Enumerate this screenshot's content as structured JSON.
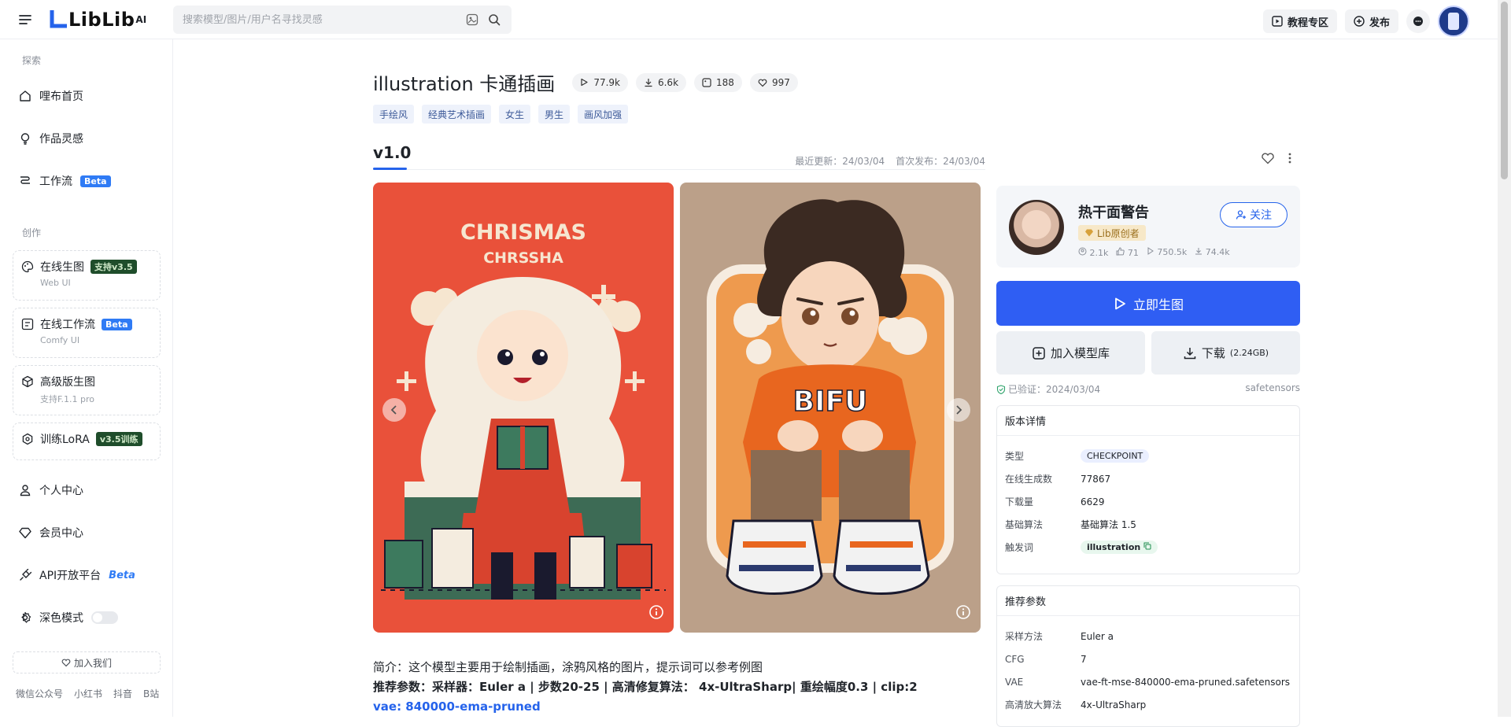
{
  "topbar": {
    "logo_text": "LibLib",
    "logo_ai": "AI",
    "search_placeholder": "搜索模型/图片/用户名寻找灵感",
    "tutorial_label": "教程专区",
    "publish_label": "发布"
  },
  "sidebar": {
    "explore_label": "探索",
    "explore_items": [
      {
        "label": "哩布首页"
      },
      {
        "label": "作品灵感"
      },
      {
        "label": "工作流",
        "badge": "Beta"
      }
    ],
    "create_label": "创作",
    "create_cards": [
      {
        "label": "在线生图",
        "badge": "支持v3.5",
        "sub": "Web UI"
      },
      {
        "label": "在线工作流",
        "badge": "Beta",
        "sub": "Comfy UI"
      },
      {
        "label": "高级版生图",
        "sub": "支持F.1.1 pro"
      },
      {
        "label": "训练LoRA",
        "badge": "v3.5训练"
      }
    ],
    "other_items": [
      {
        "label": "个人中心"
      },
      {
        "label": "会员中心"
      },
      {
        "label": "API开放平台",
        "badge": "Beta"
      },
      {
        "label": "深色模式"
      }
    ],
    "join_label": "加入我们",
    "social": [
      "微信公众号",
      "小红书",
      "抖音",
      "B站"
    ]
  },
  "model": {
    "title": "illustration 卡通插画",
    "stats": {
      "runs": "77.9k",
      "downloads": "6.6k",
      "images": "188",
      "likes": "997"
    },
    "tags": [
      "手绘风",
      "经典艺术插画",
      "女生",
      "男生",
      "画风加强"
    ],
    "version": "v1.0",
    "updated": "最近更新：24/03/04",
    "published": "首次发布：24/03/04",
    "image1_text_line1": "CHRISMAS",
    "image1_text_line2": "CHRSSHA",
    "image2_text": "BIFU"
  },
  "description": {
    "line1": "简介：这个模型主要用于绘制插画，涂鸦风格的图片，提示词可以参考例图",
    "line2": "推荐参数：采样器：Euler a | 步数20-25 | 高清修复算法： 4x-UltraSharp| 重绘幅度0.3 |  clip:2",
    "line3": "vae: 840000-ema-pruned"
  },
  "author": {
    "name": "热干面警告",
    "badge": "Lib原创者",
    "followers": "2.1k",
    "likes": "71",
    "runs": "750.5k",
    "downloads": "74.4k",
    "follow_label": "关注"
  },
  "actions": {
    "generate_label": "立即生图",
    "add_label": "加入模型库",
    "download_label": "下载",
    "download_size": "(2.24GB)",
    "verified": "已验证：2024/03/04",
    "format": "safetensors"
  },
  "version_details": {
    "title": "版本详情",
    "rows": [
      {
        "k": "类型",
        "v": "CHECKPOINT"
      },
      {
        "k": "在线生成数",
        "v": "77867"
      },
      {
        "k": "下载量",
        "v": "6629"
      },
      {
        "k": "基础算法",
        "v": "基础算法 1.5"
      },
      {
        "k": "触发词",
        "v": "illustration"
      }
    ]
  },
  "params": {
    "title": "推荐参数",
    "rows": [
      {
        "k": "采样方法",
        "v": "Euler a"
      },
      {
        "k": "CFG",
        "v": "7"
      },
      {
        "k": "VAE",
        "v": "vae-ft-mse-840000-ema-pruned.safetensors"
      },
      {
        "k": "高清放大算法",
        "v": "4x-UltraSharp"
      }
    ]
  }
}
